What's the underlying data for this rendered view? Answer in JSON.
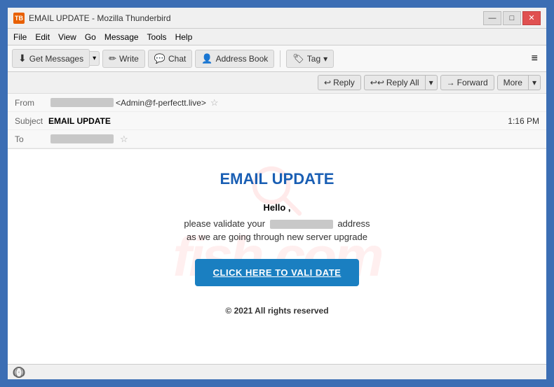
{
  "window": {
    "title": "EMAIL UPDATE - Mozilla Thunderbird",
    "icon": "TB"
  },
  "window_controls": {
    "minimize": "—",
    "maximize": "□",
    "close": "✕"
  },
  "menu": {
    "items": [
      "File",
      "Edit",
      "View",
      "Go",
      "Message",
      "Tools",
      "Help"
    ]
  },
  "toolbar": {
    "get_messages": "Get Messages",
    "write": "Write",
    "chat": "Chat",
    "address_book": "Address Book",
    "tag": "Tag",
    "dropdown_arrow": "▾",
    "hamburger": "≡"
  },
  "email_actions": {
    "reply": "Reply",
    "reply_all": "Reply All",
    "forward": "Forward",
    "more": "More",
    "dropdown_arrow": "▾"
  },
  "email_header": {
    "from_label": "From",
    "from_value": "<Admin@f-perfectt.live>",
    "subject_label": "Subject",
    "subject_value": "EMAIL UPDATE",
    "to_label": "To",
    "time": "1:16 PM"
  },
  "email_body": {
    "title": "EMAIL UPDATE",
    "hello": "Hello ,",
    "line1_before": "please validate your",
    "line1_after": "address",
    "line2": "as we are going through new server upgrade",
    "button": "CLICK HERE TO VALI DATE",
    "copyright": "© 2021 All rights reserved"
  },
  "watermark": {
    "text": "fish.com"
  },
  "status_bar": {
    "icon": "((·))"
  }
}
